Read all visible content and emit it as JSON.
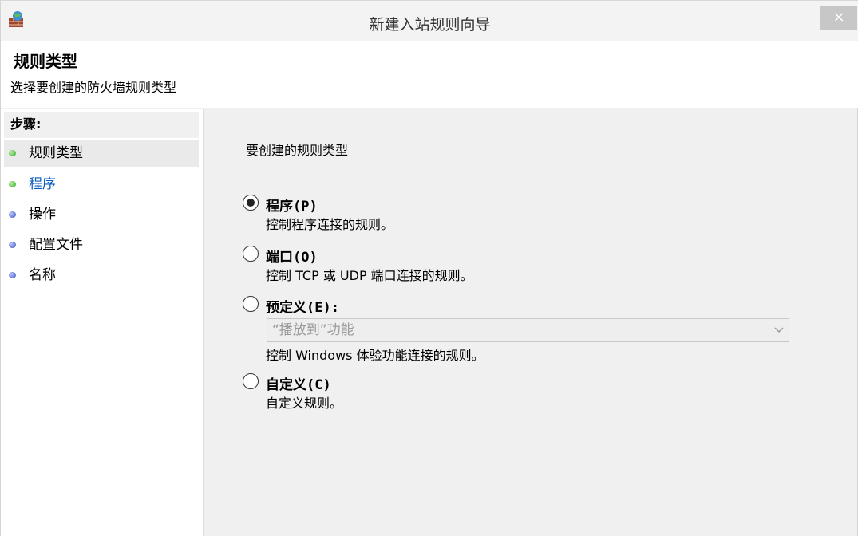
{
  "window": {
    "title": "新建入站规则向导",
    "close_label": "×"
  },
  "header": {
    "title": "规则类型",
    "subtitle": "选择要创建的防火墙规则类型"
  },
  "steps": {
    "header": "步骤:",
    "items": [
      {
        "label": "规则类型",
        "bullet": "green"
      },
      {
        "label": "程序",
        "bullet": "green"
      },
      {
        "label": "操作",
        "bullet": "blue"
      },
      {
        "label": "配置文件",
        "bullet": "blue"
      },
      {
        "label": "名称",
        "bullet": "blue"
      }
    ]
  },
  "main": {
    "prompt": "要创建的规则类型",
    "options": [
      {
        "label": "程序(P)",
        "description": "控制程序连接的规则。",
        "checked": true
      },
      {
        "label": "端口(O)",
        "description": "控制 TCP 或 UDP 端口连接的规则。",
        "checked": false
      },
      {
        "label": "预定义(E):",
        "description": "",
        "checked": false
      },
      {
        "label": "自定义(C)",
        "description": "自定义规则。",
        "checked": false
      }
    ],
    "predefined_dropdown": {
      "selected": "“播放到”功能",
      "disabled": true
    },
    "predefined_description": "控制 Windows 体验功能连接的规则。"
  },
  "icons": {
    "app": "firewall-icon",
    "close": "close-icon",
    "dropdown": "chevron-down-icon"
  },
  "colors": {
    "link": "#0b5dbd",
    "bullet_green": "#2fa52a",
    "bullet_blue": "#3a4fc0",
    "close_button": "#c7c7c7"
  }
}
